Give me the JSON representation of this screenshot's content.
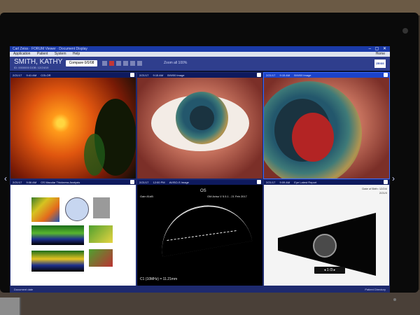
{
  "window": {
    "title": "Carl Zeiss · FORUM Viewer · Document Display",
    "menu": [
      "Application",
      "Patient",
      "System",
      "Help"
    ],
    "menu_right": "Home"
  },
  "header": {
    "patient_name": "SMITH, KATHY",
    "patient_sub": "ID: 0000000   DOB: 12/24/19",
    "compare_label": "Compare 0/0/08",
    "zoom_readout": "Zoom all   100%"
  },
  "panes": [
    {
      "date": "2/21/17",
      "time": "9:41 AM",
      "label": "COLOR"
    },
    {
      "date": "2/21/17",
      "time": "9:15 AM",
      "label": "B/W00 Image"
    },
    {
      "date": "2/21/17",
      "time": "9:15 AM",
      "label": "B/W00 Image"
    },
    {
      "date": "2/21/17",
      "time": "9:06 AM",
      "label": "OS Macular Thickness Analysis"
    },
    {
      "date": "2/21/17",
      "time": "12:00 PM",
      "label": "AVISO-S Image"
    },
    {
      "date": "2/21/17",
      "time": "9:09 AM",
      "label": "Eye Latest Report"
    }
  ],
  "ultrasound": {
    "eye": "OS",
    "gain": "Gain 81dB",
    "probe": "OM Aviso V 5.5.1 - 21 Feb 2017",
    "measure": "C1 (10MHz) = 11.21mm"
  },
  "bscan": {
    "date_of_birth_label": "Date of Birth:",
    "date_of_birth": "12/24/",
    "date_value": "2/21/0",
    "pager": "1 /3"
  },
  "status": {
    "left": "Document date",
    "right": "Patient Directory"
  },
  "colors": {
    "window_blue": "#1a3aa8",
    "header_blue": "#2f3e8d",
    "active_border": "#3a6cff"
  }
}
